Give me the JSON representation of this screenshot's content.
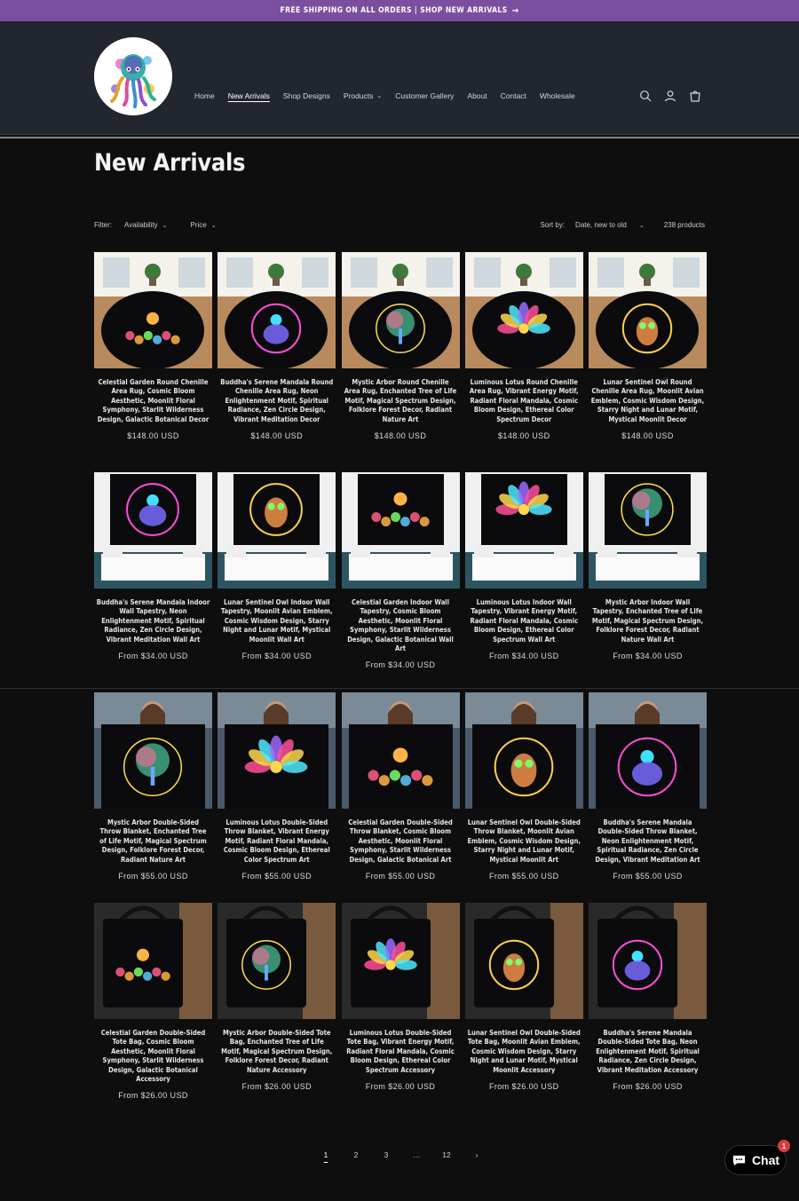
{
  "announcement": {
    "text": "FREE SHIPPING ON ALL ORDERS | SHOP NEW ARRIVALS"
  },
  "nav": {
    "items": [
      {
        "label": "Home"
      },
      {
        "label": "New Arrivals"
      },
      {
        "label": "Shop Designs"
      },
      {
        "label": "Products"
      },
      {
        "label": "Customer Gallery"
      },
      {
        "label": "About"
      },
      {
        "label": "Contact"
      },
      {
        "label": "Wholesale"
      }
    ]
  },
  "page": {
    "title": "New Arrivals"
  },
  "filters": {
    "label": "Filter:",
    "availability": "Availability",
    "price": "Price",
    "sort_label": "Sort by:",
    "sort_value": "Date, new to old",
    "count": "238 products"
  },
  "products": [
    [
      {
        "title": "Celestial Garden Round Chenille Area Rug, Cosmic Bloom Aesthetic, Moonlit Floral Symphony, Starlit Wilderness Design, Galactic Botanical Decor",
        "price": "$148.00 USD"
      },
      {
        "title": "Buddha's Serene Mandala Round Chenille Area Rug, Neon Enlightenment Motif, Spiritual Radiance, Zen Circle Design, Vibrant Meditation Decor",
        "price": "$148.00 USD"
      },
      {
        "title": "Mystic Arbor Round Chenille Area Rug, Enchanted Tree of Life Motif, Magical Spectrum Design, Folklore Forest Decor, Radiant Nature Art",
        "price": "$148.00 USD"
      },
      {
        "title": "Luminous Lotus Round Chenille Area Rug, Vibrant Energy Motif, Radiant Floral Mandala, Cosmic Bloom Design, Ethereal Color Spectrum Decor",
        "price": "$148.00 USD"
      },
      {
        "title": "Lunar Sentinel Owl Round Chenille Area Rug, Moonlit Avian Emblem, Cosmic Wisdom Design, Starry Night and Lunar Motif, Mystical Moonlit Decor",
        "price": "$148.00 USD"
      }
    ],
    [
      {
        "title": "Buddha's Serene Mandala Indoor Wall Tapestry, Neon Enlightenment Motif, Spiritual Radiance, Zen Circle Design, Vibrant Meditation Wall Art",
        "price": "From $34.00 USD"
      },
      {
        "title": "Lunar Sentinel Owl Indoor Wall Tapestry, Moonlit Avian Emblem, Cosmic Wisdom Design, Starry Night and Lunar Motif, Mystical Moonlit Wall Art",
        "price": "From $34.00 USD"
      },
      {
        "title": "Celestial Garden Indoor Wall Tapestry, Cosmic Bloom Aesthetic, Moonlit Floral Symphony, Starlit Wilderness Design, Galactic Botanical Wall Art",
        "price": "From $34.00 USD"
      },
      {
        "title": "Luminous Lotus Indoor Wall Tapestry, Vibrant Energy Motif, Radiant Floral Mandala, Cosmic Bloom Design, Ethereal Color Spectrum Wall Art",
        "price": "From $34.00 USD"
      },
      {
        "title": "Mystic Arbor Indoor Wall Tapestry, Enchanted Tree of Life Motif, Magical Spectrum Design, Folklore Forest Decor, Radiant Nature Wall Art",
        "price": "From $34.00 USD"
      }
    ],
    [
      {
        "title": "Mystic Arbor Double-Sided Throw Blanket, Enchanted Tree of Life Motif, Magical Spectrum Design, Folklore Forest Decor, Radiant Nature Art",
        "price": "From $55.00 USD"
      },
      {
        "title": "Luminous Lotus Double-Sided Throw Blanket, Vibrant Energy Motif, Radiant Floral Mandala, Cosmic Bloom Design, Ethereal Color Spectrum Art",
        "price": "From $55.00 USD"
      },
      {
        "title": "Celestial Garden Double-Sided Throw Blanket, Cosmic Bloom Aesthetic, Moonlit Floral Symphony, Starlit Wilderness Design, Galactic Botanical Art",
        "price": "From $55.00 USD"
      },
      {
        "title": "Lunar Sentinel Owl Double-Sided Throw Blanket, Moonlit Avian Emblem, Cosmic Wisdom Design, Starry Night and Lunar Motif, Mystical Moonlit Art",
        "price": "From $55.00 USD"
      },
      {
        "title": "Buddha's Serene Mandala Double-Sided Throw Blanket, Neon Enlightenment Motif, Spiritual Radiance, Zen Circle Design, Vibrant Meditation Art",
        "price": "From $55.00 USD"
      }
    ],
    [
      {
        "title": "Celestial Garden Double-Sided Tote Bag, Cosmic Bloom Aesthetic, Moonlit Floral Symphony, Starlit Wilderness Design, Galactic Botanical Accessory",
        "price": "From $26.00 USD"
      },
      {
        "title": "Mystic Arbor Double-Sided Tote Bag, Enchanted Tree of Life Motif, Magical Spectrum Design, Folklore Forest Decor, Radiant Nature Accessory",
        "price": "From $26.00 USD"
      },
      {
        "title": "Luminous Lotus Double-Sided Tote Bag, Vibrant Energy Motif, Radiant Floral Mandala, Cosmic Bloom Design, Ethereal Color Spectrum Accessory",
        "price": "From $26.00 USD"
      },
      {
        "title": "Lunar Sentinel Owl Double-Sided Tote Bag, Moonlit Avian Emblem, Cosmic Wisdom Design, Starry Night and Lunar Motif, Mystical Moonlit Accessory",
        "price": "From $26.00 USD"
      },
      {
        "title": "Buddha's Serene Mandala Double-Sided Tote Bag, Neon Enlightenment Motif, Spiritual Radiance, Zen Circle Design, Vibrant Meditation Accessory",
        "price": "From $26.00 USD"
      }
    ]
  ],
  "pagination": {
    "pages": [
      "1",
      "2",
      "3",
      "…",
      "12"
    ],
    "current": "1"
  },
  "chat": {
    "label": "Chat",
    "badge": "1"
  },
  "colors": {
    "announcement_bg": "#7b4fa0",
    "header_bg": "#22262f",
    "page_bg": "#0e0e0f",
    "chat_badge": "#e03a3a"
  }
}
